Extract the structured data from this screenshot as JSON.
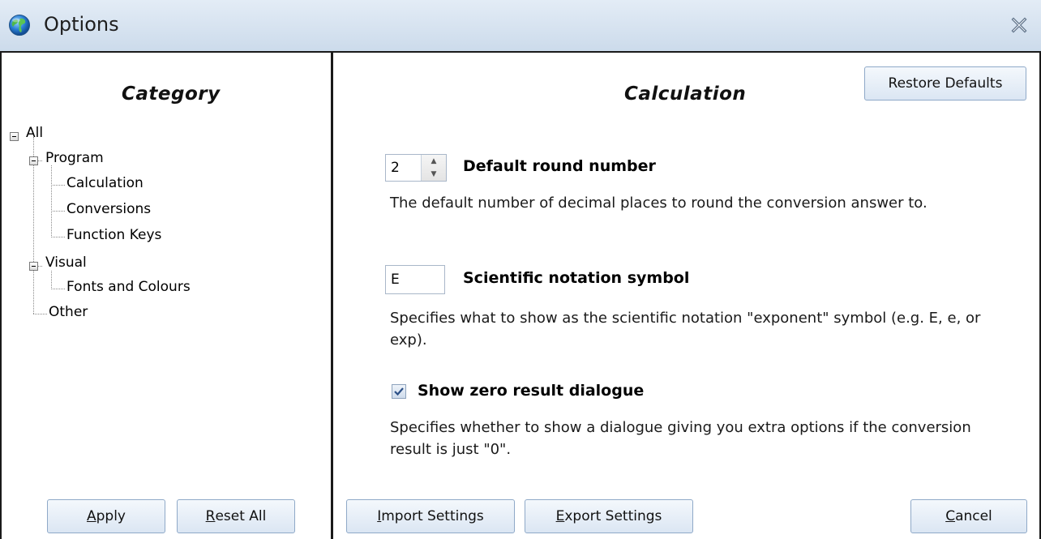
{
  "window": {
    "title": "Options"
  },
  "category": {
    "heading": "Category",
    "tree": [
      {
        "label": "All"
      },
      {
        "label": "Program"
      },
      {
        "label": "Calculation"
      },
      {
        "label": "Conversions"
      },
      {
        "label": "Function Keys"
      },
      {
        "label": "Visual"
      },
      {
        "label": "Fonts and Colours"
      },
      {
        "label": "Other"
      }
    ],
    "buttons": {
      "apply": {
        "accel": "A",
        "rest": "pply"
      },
      "reset_all": {
        "accel": "R",
        "rest": "eset All"
      }
    }
  },
  "panel": {
    "heading": "Calculation",
    "restore_defaults": "Restore Defaults",
    "round": {
      "value": "2",
      "label": "Default round number",
      "description": "The default number of decimal places to round the conversion answer to."
    },
    "sci": {
      "value": "E",
      "label": "Scientific notation symbol",
      "description": "Specifies what to show as the scientific notation \"exponent\" symbol (e.g. E, e, or exp)."
    },
    "zero": {
      "checked": true,
      "label": "Show zero result dialogue",
      "description": "Specifies whether to show a dialogue giving you extra options if the conversion result is just \"0\"."
    },
    "buttons": {
      "import": {
        "accel": "I",
        "rest": "mport Settings"
      },
      "export": {
        "accel": "E",
        "rest": "xport Settings"
      },
      "cancel": {
        "accel": "C",
        "rest": "ancel"
      }
    }
  },
  "colors": {
    "title_bar": "#ccdbeb",
    "button_border": "#8fa9c8",
    "divider": "#1a1a1a"
  }
}
